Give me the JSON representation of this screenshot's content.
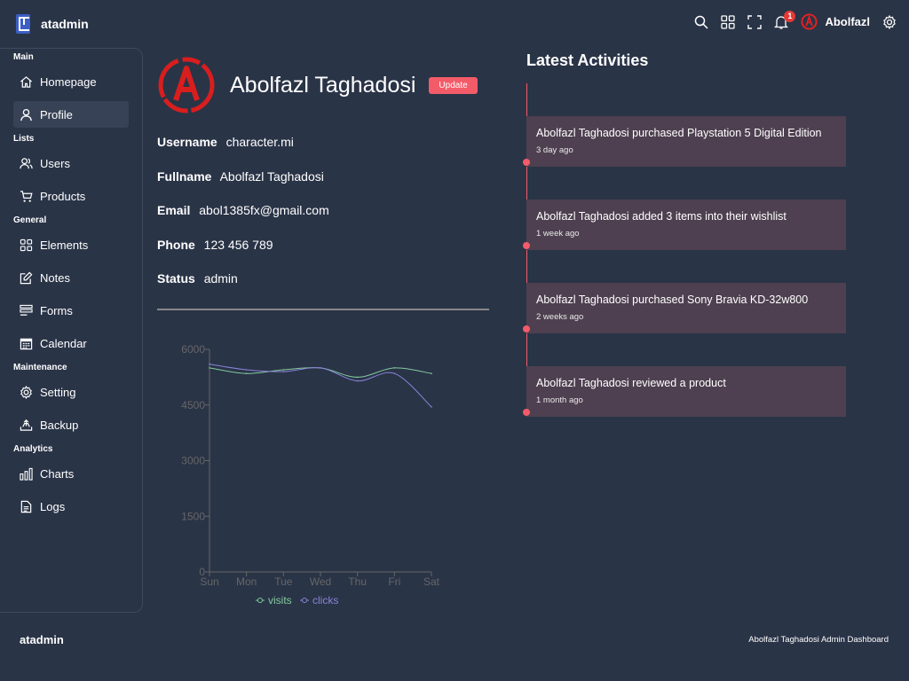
{
  "app": {
    "logo_text": "atadmin"
  },
  "header": {
    "notification_count": "1",
    "user_name": "Abolfazl",
    "icons": [
      "search-icon",
      "apps-icon",
      "fullscreen-icon",
      "bell-icon",
      "avatar",
      "gear-icon"
    ]
  },
  "sidebar": {
    "sections": [
      {
        "title": "Main",
        "items": [
          {
            "label": "Homepage",
            "icon": "home-icon"
          },
          {
            "label": "Profile",
            "icon": "user-icon",
            "active": true
          }
        ]
      },
      {
        "title": "Lists",
        "items": [
          {
            "label": "Users",
            "icon": "users-icon"
          },
          {
            "label": "Products",
            "icon": "cart-icon"
          }
        ]
      },
      {
        "title": "General",
        "items": [
          {
            "label": "Elements",
            "icon": "grid-icon"
          },
          {
            "label": "Notes",
            "icon": "notes-icon"
          },
          {
            "label": "Forms",
            "icon": "forms-icon"
          },
          {
            "label": "Calendar",
            "icon": "calendar-icon"
          }
        ]
      },
      {
        "title": "Maintenance",
        "items": [
          {
            "label": "Setting",
            "icon": "gear-icon"
          },
          {
            "label": "Backup",
            "icon": "backup-icon"
          }
        ]
      },
      {
        "title": "Analytics",
        "items": [
          {
            "label": "Charts",
            "icon": "chart-icon"
          },
          {
            "label": "Logs",
            "icon": "logs-icon"
          }
        ]
      }
    ]
  },
  "profile": {
    "name": "Abolfazl Taghadosi",
    "update_label": "Update",
    "fields": [
      {
        "key": "Username",
        "value": "character.mi"
      },
      {
        "key": "Fullname",
        "value": "Abolfazl Taghadosi"
      },
      {
        "key": "Email",
        "value": "abol1385fx@gmail.com"
      },
      {
        "key": "Phone",
        "value": "123 456 789"
      },
      {
        "key": "Status",
        "value": "admin"
      }
    ]
  },
  "chart_data": {
    "type": "line",
    "categories": [
      "Sun",
      "Mon",
      "Tue",
      "Wed",
      "Thu",
      "Fri",
      "Sat"
    ],
    "series": [
      {
        "name": "visits",
        "color": "#82ca9d",
        "values": [
          5500,
          5350,
          5450,
          5500,
          5250,
          5500,
          5350
        ]
      },
      {
        "name": "clicks",
        "color": "#8884d8",
        "values": [
          5600,
          5450,
          5400,
          5500,
          5150,
          5350,
          4450
        ]
      }
    ],
    "yticks": [
      0,
      1500,
      3000,
      4500,
      6000
    ],
    "ylim": [
      0,
      6000
    ],
    "grid": false,
    "legend": "bottom"
  },
  "activities": {
    "title": "Latest Activities",
    "items": [
      {
        "text": "Abolfazl Taghadosi purchased Playstation 5 Digital Edition",
        "time": "3 day ago"
      },
      {
        "text": "Abolfazl Taghadosi added 3 items into their wishlist",
        "time": "1 week ago"
      },
      {
        "text": "Abolfazl Taghadosi purchased Sony Bravia KD-32w800",
        "time": "2 weeks ago"
      },
      {
        "text": "Abolfazl Taghadosi reviewed a product",
        "time": "1 month ago"
      }
    ]
  },
  "footer": {
    "left": "atadmin",
    "right": "Abolfazl Taghadosi Admin Dashboard"
  },
  "colors": {
    "background": "#2a3447",
    "accent": "#f45b69",
    "activity_bg": "#4e4050"
  }
}
